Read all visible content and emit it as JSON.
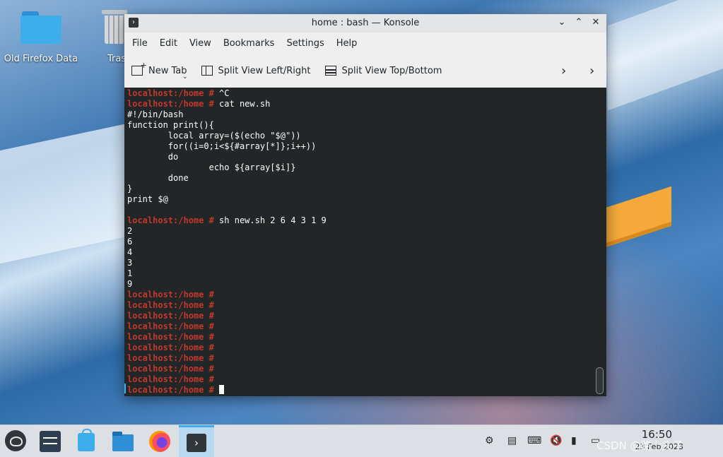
{
  "desktop": {
    "icons": [
      {
        "label": "Old Firefox Data",
        "icon": "folder-icon"
      },
      {
        "label": "Tras",
        "icon": "trash-icon"
      }
    ]
  },
  "window": {
    "title": "home : bash — Konsole",
    "menu": [
      "File",
      "Edit",
      "View",
      "Bookmarks",
      "Settings",
      "Help"
    ],
    "toolbar": {
      "new_tab": "New Tab",
      "split_lr": "Split View Left/Right",
      "split_tb": "Split View Top/Bottom"
    }
  },
  "terminal": {
    "prompt": "localhost:/home #",
    "lines": [
      {
        "prompt": true,
        "text": " ^C"
      },
      {
        "prompt": true,
        "text": " cat new.sh"
      },
      {
        "prompt": false,
        "text": "#!/bin/bash"
      },
      {
        "prompt": false,
        "text": "function print(){"
      },
      {
        "prompt": false,
        "text": "        local array=($(echo \"$@\"))"
      },
      {
        "prompt": false,
        "text": "        for((i=0;i<${#array[*]};i++))"
      },
      {
        "prompt": false,
        "text": "        do"
      },
      {
        "prompt": false,
        "text": "                echo ${array[$i]}"
      },
      {
        "prompt": false,
        "text": "        done"
      },
      {
        "prompt": false,
        "text": "}"
      },
      {
        "prompt": false,
        "text": "print $@"
      },
      {
        "prompt": false,
        "text": ""
      },
      {
        "prompt": true,
        "text": " sh new.sh 2 6 4 3 1 9"
      },
      {
        "prompt": false,
        "text": "2"
      },
      {
        "prompt": false,
        "text": "6"
      },
      {
        "prompt": false,
        "text": "4"
      },
      {
        "prompt": false,
        "text": "3"
      },
      {
        "prompt": false,
        "text": "1"
      },
      {
        "prompt": false,
        "text": "9"
      },
      {
        "prompt": true,
        "text": ""
      },
      {
        "prompt": true,
        "text": ""
      },
      {
        "prompt": true,
        "text": ""
      },
      {
        "prompt": true,
        "text": ""
      },
      {
        "prompt": true,
        "text": ""
      },
      {
        "prompt": true,
        "text": ""
      },
      {
        "prompt": true,
        "text": ""
      },
      {
        "prompt": true,
        "text": ""
      },
      {
        "prompt": true,
        "text": ""
      },
      {
        "prompt": true,
        "text": " ",
        "cursor": true
      }
    ]
  },
  "taskbar": {
    "clock_time": "16:50",
    "clock_date": "23 Feb 2023",
    "watermark": "CSDN @路上头子"
  }
}
